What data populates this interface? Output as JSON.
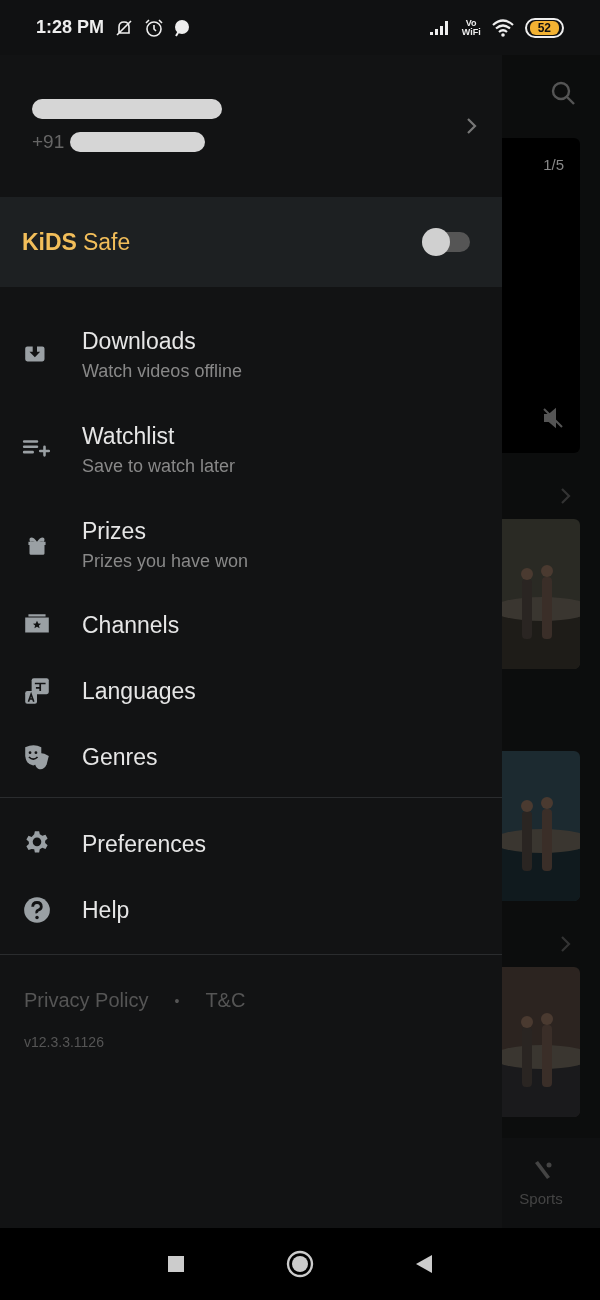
{
  "status_bar": {
    "time": "1:28 PM",
    "battery": "52",
    "vowifi": [
      "Vo",
      "WiFi"
    ]
  },
  "profile": {
    "phone_prefix": "+91"
  },
  "kids_safe": {
    "logo": "KiDS",
    "label": "Safe",
    "on": false
  },
  "menu": [
    {
      "kind": "download",
      "title": "Downloads",
      "subtitle": "Watch videos offline"
    },
    {
      "kind": "watchlist",
      "title": "Watchlist",
      "subtitle": "Save to watch later"
    },
    {
      "kind": "gift",
      "title": "Prizes",
      "subtitle": "Prizes you have won"
    },
    {
      "kind": "channels",
      "title": "Channels"
    },
    {
      "kind": "language",
      "title": "Languages"
    },
    {
      "kind": "masks",
      "title": "Genres"
    }
  ],
  "settings": [
    {
      "kind": "gear",
      "title": "Preferences"
    },
    {
      "kind": "help",
      "title": "Help"
    }
  ],
  "footer": {
    "links": [
      "Privacy Policy",
      "T&C"
    ],
    "separator": "•",
    "version": "v12.3.3.1126"
  },
  "background": {
    "counter": "1/5",
    "tab_label": "Sports"
  }
}
